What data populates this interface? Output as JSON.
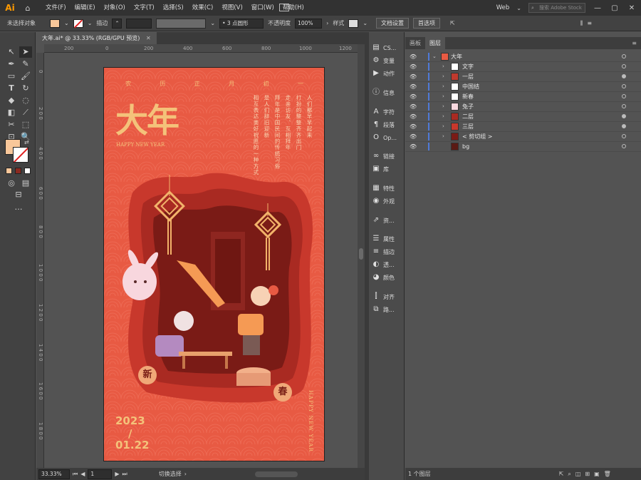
{
  "app": {
    "logo": "Ai",
    "workspace": "Web",
    "stock_search_placeholder": "搜索 Adobe Stock"
  },
  "menu": [
    "文件(F)",
    "编辑(E)",
    "对象(O)",
    "文字(T)",
    "选择(S)",
    "效果(C)",
    "视图(V)",
    "窗口(W)",
    "帮助(H)"
  ],
  "control": {
    "selection": "未选择对象",
    "stroke_label": "描边",
    "brush": "3 点圆形",
    "opacity_label": "不透明度",
    "opacity": "100%",
    "style_label": "样式",
    "doc_setup": "文档设置",
    "prefs": "首选项",
    "fill_color": "#f8c79a"
  },
  "document": {
    "tab": "大年.ai* @ 33.33% (RGB/GPU 预览)",
    "zoom": "33.33%",
    "artboard": "1",
    "status": "切换选择",
    "ruler_h": [
      "200",
      "0",
      "200",
      "400",
      "600",
      "800",
      "1000",
      "1200"
    ],
    "ruler_v": [
      "0",
      "2 0 0",
      "4 0 0",
      "6 0 0",
      "8 0 0",
      "1 0 0 0",
      "1 2 0 0",
      "1 4 0 0",
      "1 6 0 0",
      "1 8 0 0"
    ]
  },
  "poster": {
    "title": "大年",
    "subtitle": "HAPPY NEW YEAR",
    "lunar": [
      "农",
      "历",
      "正",
      "月",
      "初",
      "一"
    ],
    "poem": [
      "人们都早早起来",
      "打扮的整整齐齐出门",
      "走亲访友、互相拜年",
      "拜年是中国民间的传统习俗",
      "是人们辞旧迎新",
      "相互表达美好祝愿的一种方式"
    ],
    "year": "2023",
    "slash": "/",
    "day": "01.22",
    "side": "HAPPY NEW YEAR",
    "seal_left": "新",
    "seal_right": "春",
    "bg_color": "#e85a43",
    "gold": "#f4c27a"
  },
  "dock": [
    "CS...",
    "变量",
    "动作",
    "信息",
    "字符",
    "段落",
    "Op...",
    "链接",
    "库",
    "特性",
    "外观",
    "资...",
    "属性",
    "描边",
    "透...",
    "颜色",
    "对齐",
    "路..."
  ],
  "layers": {
    "tabs": [
      "画板",
      "图层"
    ],
    "rows": [
      {
        "name": "大年",
        "level": 0
      },
      {
        "name": "文字",
        "level": 1
      },
      {
        "name": "一层",
        "level": 1
      },
      {
        "name": "中国结",
        "level": 1
      },
      {
        "name": "新春",
        "level": 1
      },
      {
        "name": "兔子",
        "level": 1
      },
      {
        "name": "二层",
        "level": 1
      },
      {
        "name": "三层",
        "level": 1
      },
      {
        "name": "< 剪切组 >",
        "level": 1
      },
      {
        "name": "bg",
        "level": 1
      }
    ],
    "count": "1 个图层"
  }
}
